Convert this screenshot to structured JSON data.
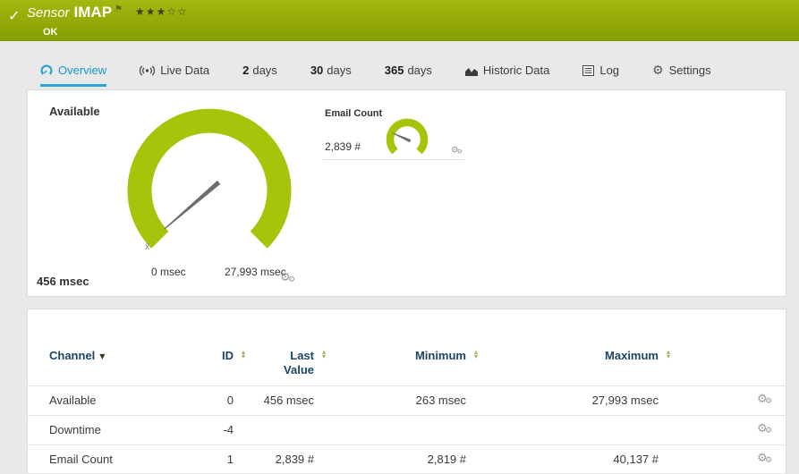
{
  "header": {
    "type_label": "Sensor",
    "name": "IMAP",
    "status": "OK"
  },
  "tabs": [
    {
      "num": "",
      "label": "Overview"
    },
    {
      "num": "",
      "label": "Live Data"
    },
    {
      "num": "2",
      "label": "days"
    },
    {
      "num": "30",
      "label": "days"
    },
    {
      "num": "365",
      "label": "days"
    },
    {
      "num": "",
      "label": "Historic Data"
    },
    {
      "num": "",
      "label": "Log"
    },
    {
      "num": "",
      "label": "Settings"
    }
  ],
  "gauges": {
    "available": {
      "title": "Available",
      "value": "456 msec",
      "scale_min": "0 msec",
      "scale_max": "27,993 msec",
      "avg_marker": "x̄"
    },
    "email_count": {
      "title": "Email Count",
      "value": "2,839 #"
    }
  },
  "table": {
    "headers": {
      "channel": "Channel",
      "id": "ID",
      "last_value": "Last Value",
      "minimum": "Minimum",
      "maximum": "Maximum"
    },
    "rows": [
      {
        "channel": "Available",
        "id": "0",
        "last_value": "456 msec",
        "minimum": "263 msec",
        "maximum": "27,993 msec"
      },
      {
        "channel": "Downtime",
        "id": "-4",
        "last_value": "",
        "minimum": "",
        "maximum": ""
      },
      {
        "channel": "Email Count",
        "id": "1",
        "last_value": "2,839 #",
        "minimum": "2,819 #",
        "maximum": "40,137 #"
      }
    ]
  },
  "icons": {
    "check": "✓",
    "flag": "⚑",
    "stars": "★★★☆☆",
    "gear": "⚙",
    "sort_desc": "▼",
    "sort_up": "▴",
    "sort_down": "▾"
  },
  "colors": {
    "header_green_top": "#a4b80f",
    "header_green_bottom": "#859e02",
    "gauge_green": "#a8c40a",
    "active_tab_blue": "#1998cf"
  }
}
